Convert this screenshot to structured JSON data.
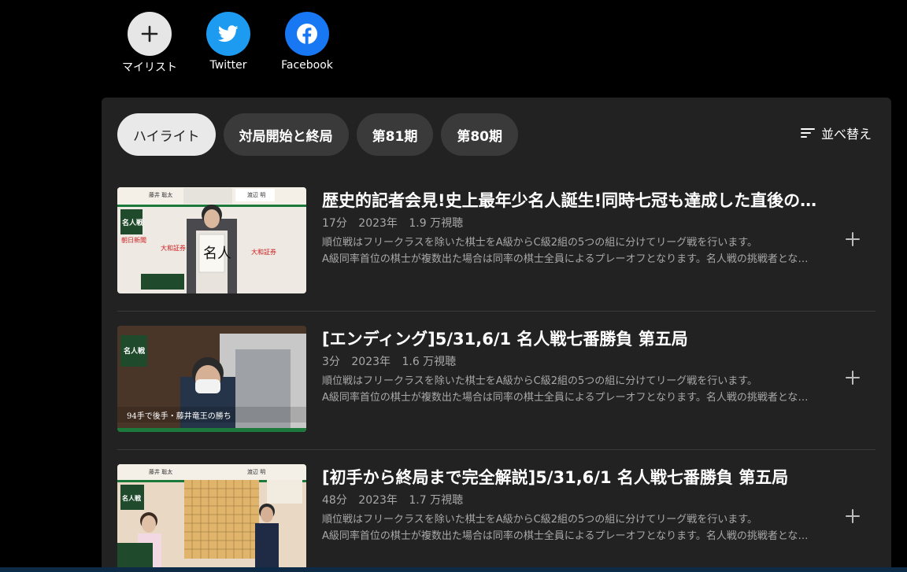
{
  "share": {
    "mylist_label": "マイリスト",
    "twitter_label": "Twitter",
    "facebook_label": "Facebook"
  },
  "tabs": [
    {
      "label": "ハイライト",
      "active": true
    },
    {
      "label": "対局開始と終局",
      "active": false
    },
    {
      "label": "第81期",
      "active": false
    },
    {
      "label": "第80期",
      "active": false
    }
  ],
  "sort_label": "並べ替え",
  "videos": [
    {
      "title": "歴史的記者会見!史上最年少名人誕生!同時七冠も達成した直後の藤井聡太新名人",
      "duration": "17分",
      "year": "2023年",
      "views": "1.9 万視聴",
      "desc_line1": "順位戦はフリークラスを除いた棋士をA級からC級2組の5つの組に分けてリーグ戦を行います。",
      "desc_line2": "A級同率首位の棋士が複数出た場合は同率の棋士全員によるプレーオフとなります。名人戦の挑戦者となります。",
      "thumb_banner_left": "藤井 聡太",
      "thumb_banner_right": "渡辺 明",
      "thumb_badge": "名人戦",
      "thumb_board_text": "名人"
    },
    {
      "title": "[エンディング]5/31,6/1 名人戦七番勝負 第五局",
      "duration": "3分",
      "year": "2023年",
      "views": "1.6 万視聴",
      "desc_line1": "順位戦はフリークラスを除いた棋士をA級からC級2組の5つの組に分けてリーグ戦を行います。",
      "desc_line2": "A級同率首位の棋士が複数出た場合は同率の棋士全員によるプレーオフとなります。名人戦の挑戦者となります。",
      "thumb_badge": "名人戦",
      "thumb_caption": "94手で後手・藤井竜王の勝ち"
    },
    {
      "title": "[初手から終局まで完全解説]5/31,6/1 名人戦七番勝負 第五局",
      "duration": "48分",
      "year": "2023年",
      "views": "1.7 万視聴",
      "desc_line1": "順位戦はフリークラスを除いた棋士をA級からC級2組の5つの組に分けてリーグ戦を行います。",
      "desc_line2": "A級同率首位の棋士が複数出た場合は同率の棋士全員によるプレーオフとなります。名人戦の挑戦者となります。",
      "thumb_banner_left": "藤井 聡太",
      "thumb_banner_right": "渡辺 明",
      "thumb_badge": "名人戦"
    }
  ]
}
